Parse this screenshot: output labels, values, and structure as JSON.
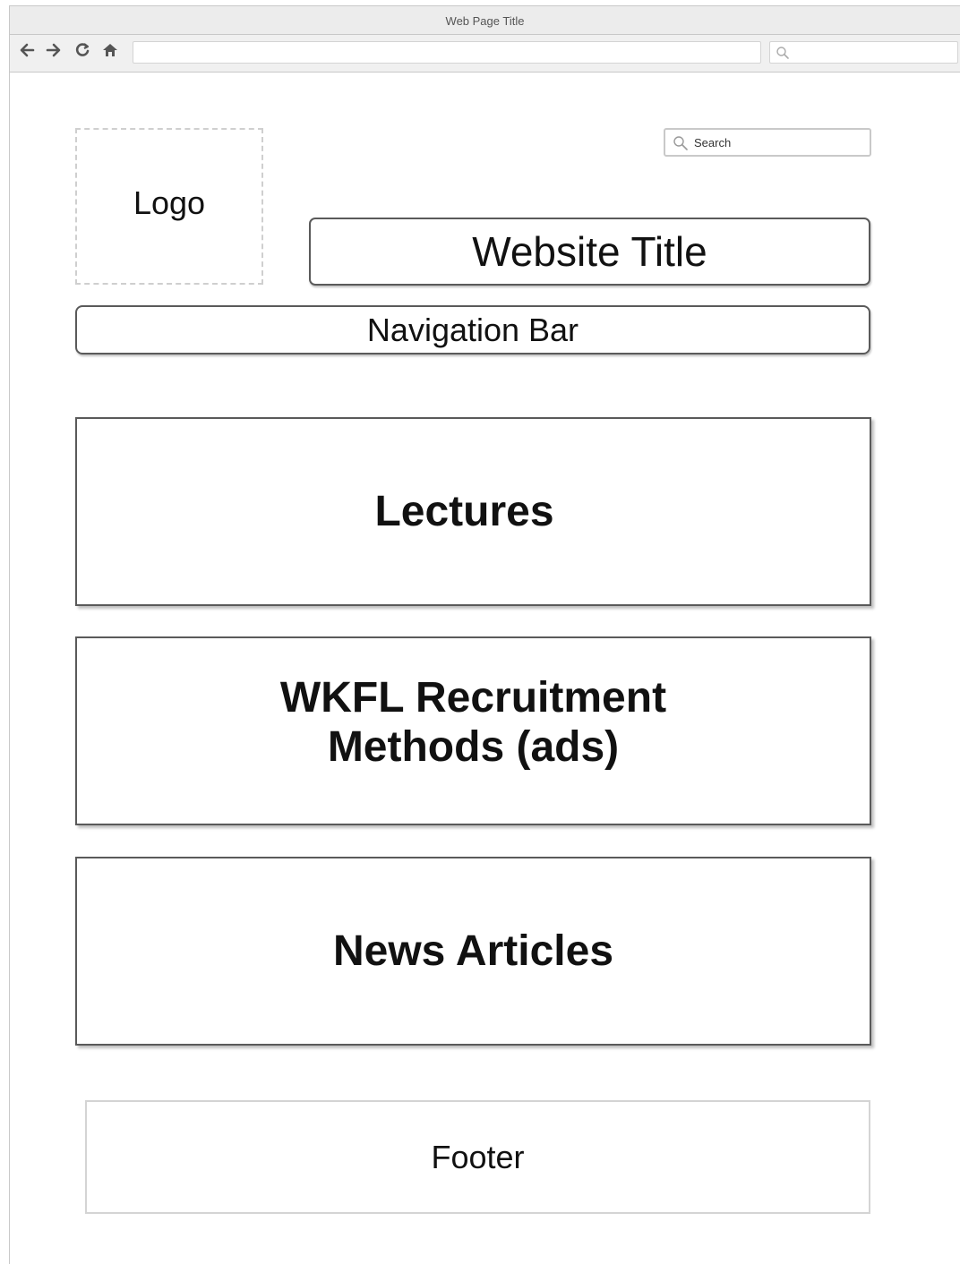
{
  "browser": {
    "window_title": "Web Page Title",
    "icons": {
      "back": "back-arrow-icon",
      "forward": "forward-arrow-icon",
      "reload": "reload-icon",
      "home": "home-icon",
      "search": "search-icon"
    }
  },
  "header": {
    "logo_label": "Logo",
    "search_placeholder": "Search",
    "website_title": "Website Title"
  },
  "navigation": {
    "label": "Navigation Bar"
  },
  "main": {
    "blocks": [
      {
        "label": "Lectures"
      },
      {
        "label_line1": "WKFL Recruitment",
        "label_line2": "Methods (ads)"
      },
      {
        "label": "News Articles"
      }
    ]
  },
  "footer": {
    "label": "Footer"
  }
}
